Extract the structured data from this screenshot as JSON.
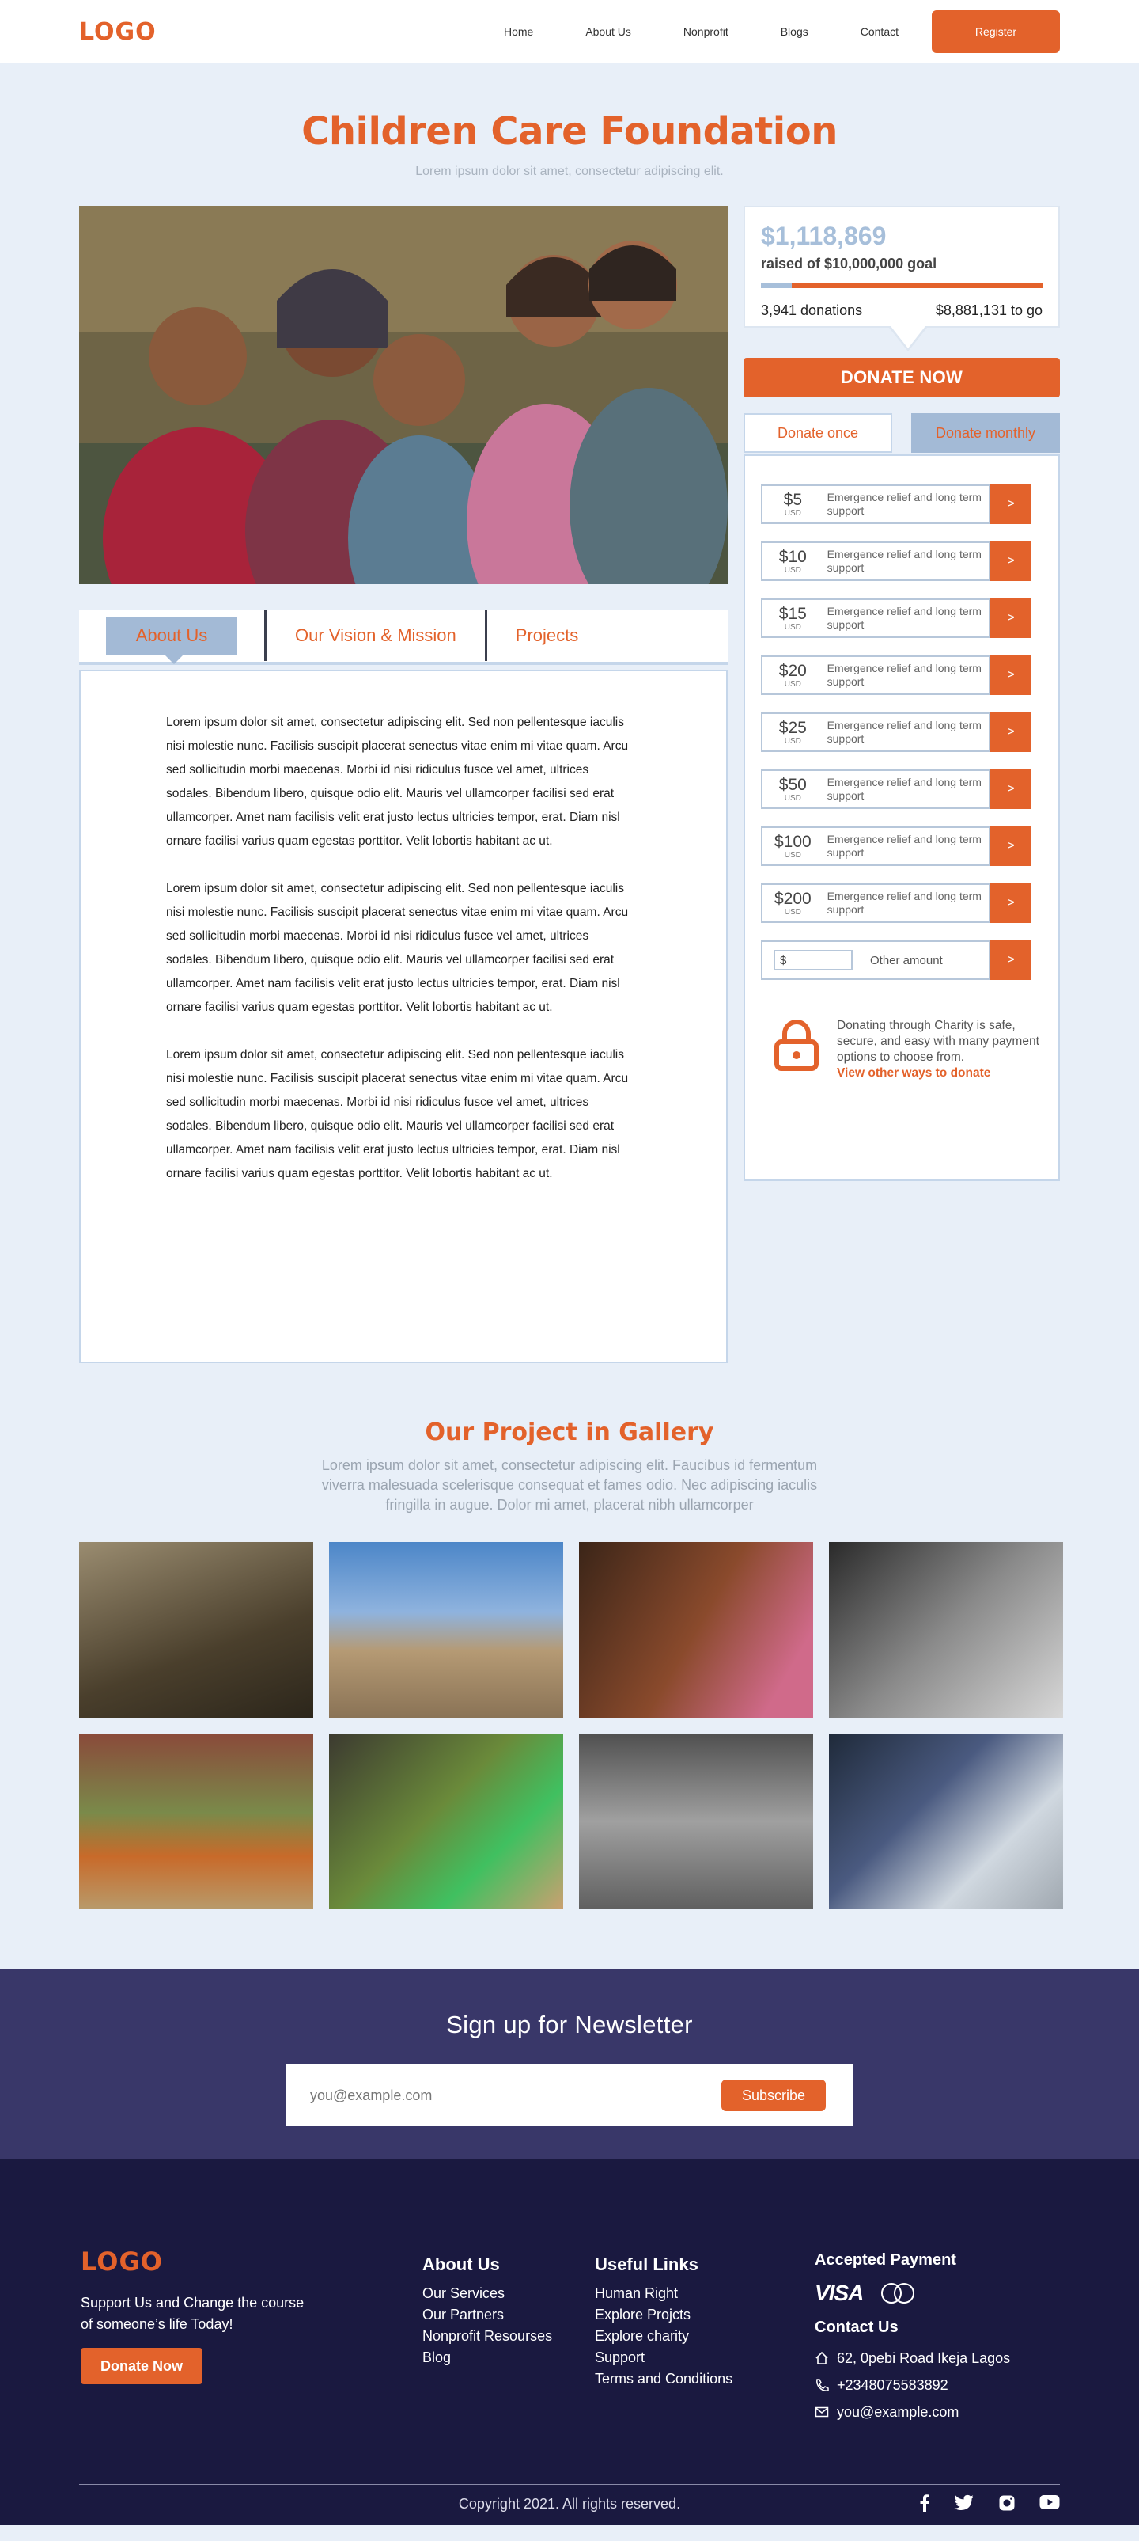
{
  "header": {
    "logo": "LOGO",
    "nav": [
      "Home",
      "About Us",
      "Nonprofit",
      "Blogs",
      "Contact"
    ],
    "register_label": "Register"
  },
  "hero": {
    "title": "Children Care Foundation",
    "subtitle": "Lorem ipsum dolor sit amet, consectetur adipiscing elit."
  },
  "tabs": [
    "About Us",
    "Our Vision & Mission",
    "Projects"
  ],
  "about_paragraphs": [
    "Lorem ipsum dolor sit amet, consectetur adipiscing elit. Sed non pellentesque iaculis nisi molestie nunc. Facilisis suscipit placerat senectus vitae enim mi vitae quam. Arcu sed sollicitudin morbi maecenas. Morbi id nisi ridiculus fusce vel amet, ultrices sodales. Bibendum libero, quisque odio elit. Mauris vel ullamcorper facilisi sed erat ullamcorper. Amet nam facilisis velit erat justo lectus ultricies tempor, erat. Diam nisl ornare facilisi varius quam egestas porttitor. Velit lobortis habitant ac ut.",
    "Lorem ipsum dolor sit amet, consectetur adipiscing elit. Sed non pellentesque iaculis nisi molestie nunc. Facilisis suscipit placerat senectus vitae enim mi vitae quam. Arcu sed sollicitudin morbi maecenas. Morbi id nisi ridiculus fusce vel amet, ultrices sodales. Bibendum libero, quisque odio elit. Mauris vel ullamcorper facilisi sed erat ullamcorper. Amet nam facilisis velit erat justo lectus ultricies tempor, erat. Diam nisl ornare facilisi varius quam egestas porttitor. Velit lobortis habitant ac ut.",
    "Lorem ipsum dolor sit amet, consectetur adipiscing elit. Sed non pellentesque iaculis nisi molestie nunc. Facilisis suscipit placerat senectus vitae enim mi vitae quam. Arcu sed sollicitudin morbi maecenas. Morbi id nisi ridiculus fusce vel amet, ultrices sodales. Bibendum libero, quisque odio elit. Mauris vel ullamcorper facilisi sed erat ullamcorper. Amet nam facilisis velit erat justo lectus ultricies tempor, erat. Diam nisl ornare facilisi varius quam egestas porttitor. Velit lobortis habitant ac ut."
  ],
  "fundraising": {
    "raised": "$1,118,869",
    "goal_text": "raised of $10,000,000 goal",
    "progress": 0.11,
    "donations": "3,941 donations",
    "remaining": "$8,881,131 to go"
  },
  "donate_now_label": "DONATE NOW",
  "donation_tabs": [
    "Donate once",
    "Donate monthly"
  ],
  "donation_options": [
    {
      "amount": "$5",
      "currency": "USD",
      "desc": "Emergence relief and long term support",
      "go": ">"
    },
    {
      "amount": "$10",
      "currency": "USD",
      "desc": "Emergence relief and long term support",
      "go": ">"
    },
    {
      "amount": "$15",
      "currency": "USD",
      "desc": "Emergence relief and long term support",
      "go": ">"
    },
    {
      "amount": "$20",
      "currency": "USD",
      "desc": "Emergence relief and long term support",
      "go": ">"
    },
    {
      "amount": "$25",
      "currency": "USD",
      "desc": "Emergence relief and long term support",
      "go": ">"
    },
    {
      "amount": "$50",
      "currency": "USD",
      "desc": "Emergence relief and long term support",
      "go": ">"
    },
    {
      "amount": "$100",
      "currency": "USD",
      "desc": "Emergence relief and long term support",
      "go": ">"
    },
    {
      "amount": "$200",
      "currency": "USD",
      "desc": "Emergence relief and long term support",
      "go": ">"
    }
  ],
  "other_amount": {
    "value": "$",
    "label": "Other amount",
    "go": ">"
  },
  "secure": {
    "text": "Donating through Charity is safe, secure, and easy with many payment options to choose from.",
    "link": "View other ways to donate"
  },
  "gallery": {
    "title": "Our Project in Gallery",
    "subtitle": "Lorem ipsum dolor sit amet, consectetur adipiscing elit. Faucibus id fermentum viverra malesuada scelerisque consequat et fames odio. Nec adipiscing iaculis fringilla in augue. Dolor mi amet, placerat nibh ullamcorper"
  },
  "newsletter": {
    "title": "Sign up for Newsletter",
    "placeholder": "you@example.com",
    "subscribe_label": "Subscribe"
  },
  "footer": {
    "logo": "LOGO",
    "tagline": "Support Us and Change the course of someone’s life Today!",
    "donate_label": "Donate Now",
    "about_title": "About Us",
    "about_links": [
      "Our Services",
      "Our Partners",
      "Nonprofit Resourses",
      "Blog"
    ],
    "useful_title": "Useful Links",
    "useful_links": [
      "Human Right",
      "Explore Projcts",
      "Explore charity",
      "Support",
      "Terms and Conditions"
    ],
    "payment_title": "Accepted Payment",
    "visa": "VISA",
    "contact_title": "Contact Us",
    "address": "62, 0pebi Road  Ikeja Lagos",
    "phone": "+2348075583892",
    "email": "you@example.com",
    "copyright": "Copyright 2021. All rights reserved."
  },
  "colors": {
    "accent": "#e3622b",
    "soft_blue": "#a3bad6",
    "navy": "#393769",
    "dark_navy": "#1a1940"
  }
}
